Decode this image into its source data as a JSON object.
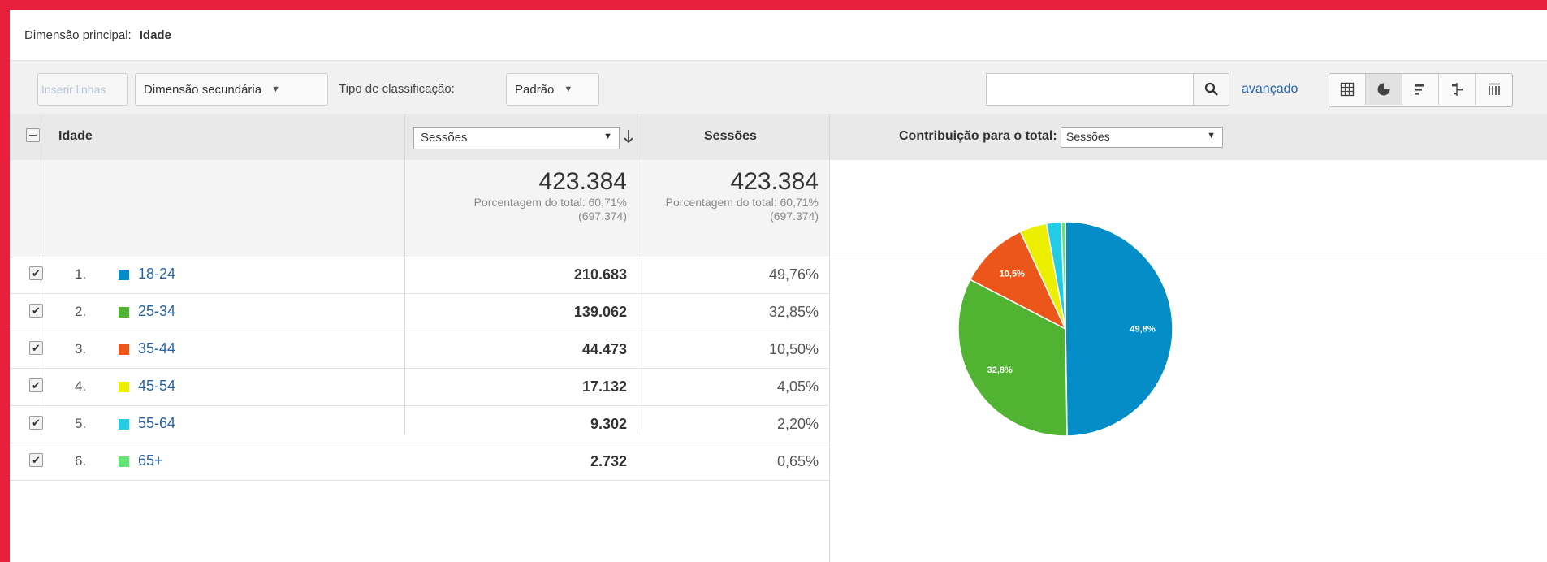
{
  "primary_dimension": {
    "label": "Dimensão principal:",
    "value": "Idade"
  },
  "toolbar": {
    "insert_rows": "Inserir linhas",
    "secondary_dimension": "Dimensão secundária",
    "sort_type_label": "Tipo de classificação:",
    "sort_type_value": "Padrão",
    "search_placeholder": "",
    "advanced_link": "avançado",
    "view_buttons": [
      "table-view-icon",
      "pie-view-icon",
      "bar-view-icon",
      "comparison-view-icon",
      "pivot-view-icon"
    ],
    "active_view": "pie-view-icon"
  },
  "table": {
    "header": {
      "dimension": "Idade",
      "metric_select": "Sessões",
      "metric_col": "Sessões",
      "contribution_label": "Contribuição para o total:",
      "contribution_select": "Sessões"
    },
    "totals": {
      "metric_value": "423.384",
      "metric_sub1": "Porcentagem do total: 60,71%",
      "metric_sub2": "(697.374)",
      "col_value": "423.384",
      "col_sub1": "Porcentagem do total: 60,71%",
      "col_sub2": "(697.374)"
    },
    "rows": [
      {
        "num": "1.",
        "label": "18-24",
        "color": "#058dc7",
        "sessions": "210.683",
        "percent": "49,76%"
      },
      {
        "num": "2.",
        "label": "25-34",
        "color": "#50b432",
        "sessions": "139.062",
        "percent": "32,85%"
      },
      {
        "num": "3.",
        "label": "35-44",
        "color": "#ed561b",
        "sessions": "44.473",
        "percent": "10,50%"
      },
      {
        "num": "4.",
        "label": "45-54",
        "color": "#edef00",
        "sessions": "17.132",
        "percent": "4,05%"
      },
      {
        "num": "5.",
        "label": "55-64",
        "color": "#24cbe5",
        "sessions": "9.302",
        "percent": "2,20%"
      },
      {
        "num": "6.",
        "label": "65+",
        "color": "#64e572",
        "sessions": "2.732",
        "percent": "0,65%"
      }
    ]
  },
  "chart_data": {
    "type": "pie",
    "categories": [
      "18-24",
      "25-34",
      "35-44",
      "45-54",
      "55-64",
      "65+"
    ],
    "values": [
      49.76,
      32.85,
      10.5,
      4.05,
      2.2,
      0.65
    ],
    "colors": [
      "#058dc7",
      "#50b432",
      "#ed561b",
      "#edef00",
      "#24cbe5",
      "#64e572"
    ],
    "slice_labels": [
      "49,8%",
      "32,8%",
      "10,5%",
      "",
      "",
      ""
    ]
  }
}
